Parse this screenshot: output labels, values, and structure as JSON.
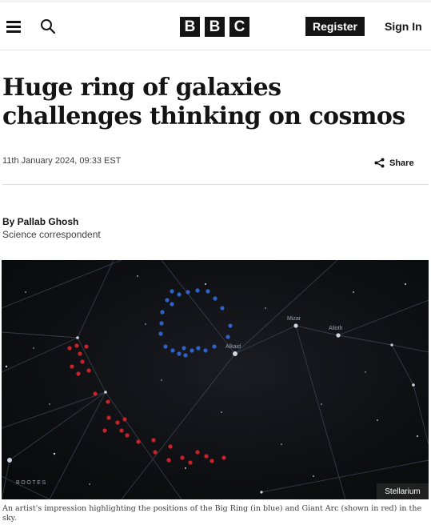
{
  "header": {
    "logo_letters": [
      "B",
      "B",
      "C"
    ],
    "register_label": "Register",
    "signin_label": "Sign In"
  },
  "article": {
    "headline": "Huge ring of galaxies challenges thinking on cosmos",
    "date": "11th January 2024, 09:33 EST",
    "share_label": "Share",
    "author": "By Pallab Ghosh",
    "author_role": "Science correspondent"
  },
  "image": {
    "star_labels": {
      "mizar": "Mizar",
      "alioth": "Alioth",
      "alkaid": "Alkaid",
      "bootes": "BOOTES"
    },
    "credit": "Stellarium",
    "big_ring_color": "#2f62c9",
    "giant_arc_color": "#c8222a",
    "caption": "An artist's impression highlighting the positions of the Big Ring (in blue) and Giant Arc (shown in red) in the sky."
  }
}
